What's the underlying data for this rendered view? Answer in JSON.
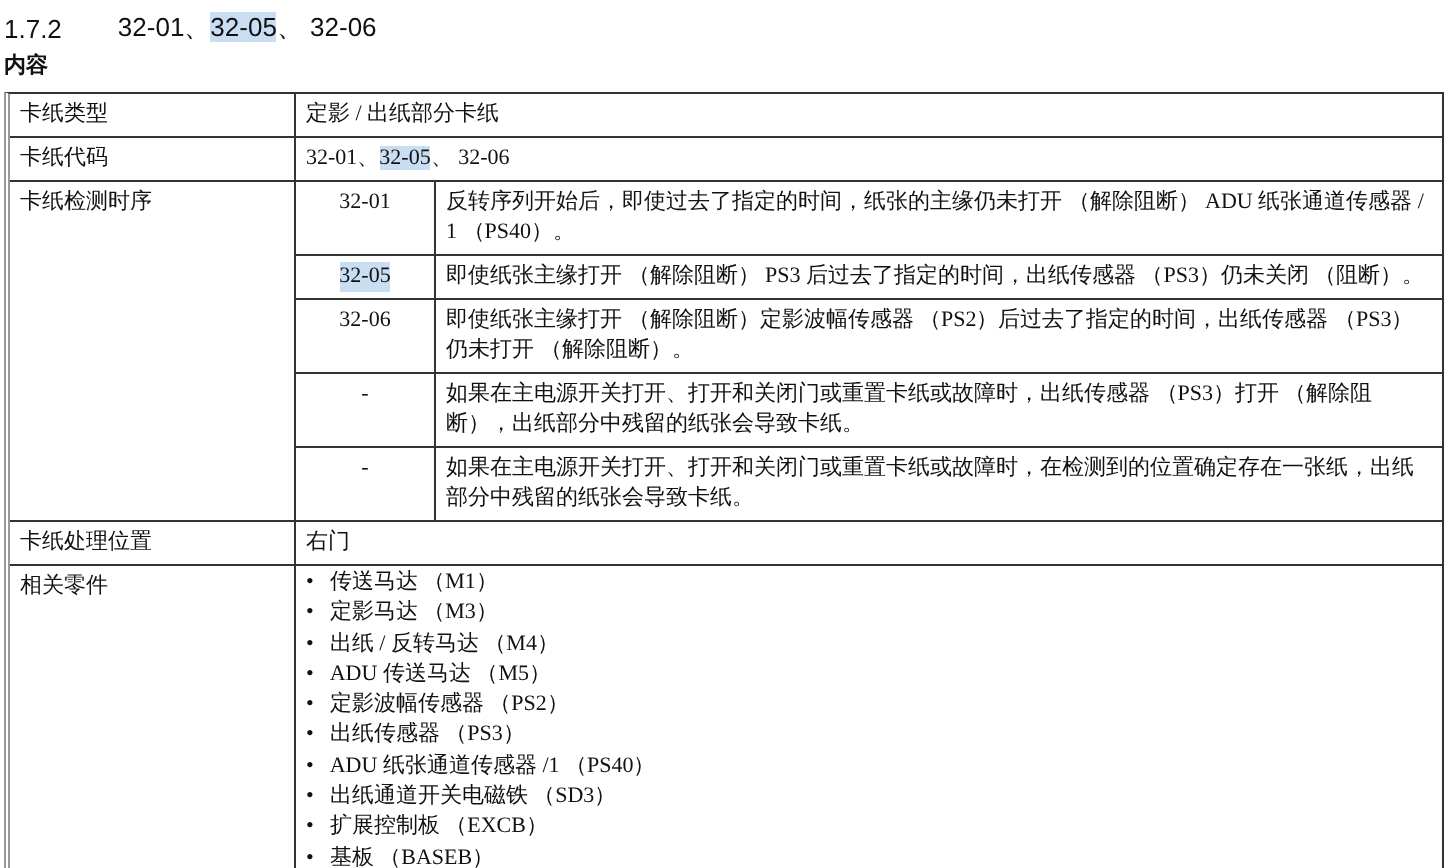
{
  "heading": {
    "number": "1.7.2",
    "codes": [
      {
        "text": "32-01、",
        "highlighted": false
      },
      {
        "text": "32-05",
        "highlighted": true
      },
      {
        "text": "、 32-06",
        "highlighted": false
      }
    ]
  },
  "section_label": "内容",
  "table": {
    "rows": [
      {
        "kind": "text",
        "label": "卡纸类型",
        "value": "定影 / 出纸部分卡纸"
      },
      {
        "kind": "codes",
        "label": "卡纸代码",
        "codes": [
          {
            "text": "32-01、",
            "highlighted": false
          },
          {
            "text": "32-05",
            "highlighted": true
          },
          {
            "text": "、 32-06",
            "highlighted": false
          }
        ]
      },
      {
        "kind": "sequence",
        "label": "卡纸检测时序",
        "entries": [
          {
            "code": "32-01",
            "highlighted": false,
            "description": "反转序列开始后，即使过去了指定的时间，纸张的主缘仍未打开 （解除阻断） ADU 纸张通道传感器 / 1 （PS40）。"
          },
          {
            "code": "32-05",
            "highlighted": true,
            "description": "即使纸张主缘打开 （解除阻断） PS3 后过去了指定的时间，出纸传感器 （PS3）仍未关闭 （阻断）。"
          },
          {
            "code": "32-06",
            "highlighted": false,
            "description": "即使纸张主缘打开 （解除阻断）定影波幅传感器 （PS2）后过去了指定的时间，出纸传感器 （PS3）仍未打开 （解除阻断）。"
          },
          {
            "code": "-",
            "highlighted": false,
            "description": "如果在主电源开关打开、打开和关闭门或重置卡纸或故障时，出纸传感器 （PS3）打开 （解除阻断），出纸部分中残留的纸张会导致卡纸。"
          },
          {
            "code": "-",
            "highlighted": false,
            "description": "如果在主电源开关打开、打开和关闭门或重置卡纸或故障时，在检测到的位置确定存在一张纸，出纸部分中残留的纸张会导致卡纸。"
          }
        ]
      },
      {
        "kind": "text",
        "label": "卡纸处理位置",
        "value": "右门"
      },
      {
        "kind": "list",
        "label": "相关零件",
        "marker": "•",
        "items": [
          "传送马达 （M1）",
          "定影马达 （M3）",
          "出纸 / 反转马达 （M4）",
          "ADU 传送马达 （M5）",
          "定影波幅传感器 （PS2）",
          "出纸传感器 （PS3）",
          "ADU 纸张通道传感器 /1 （PS40）",
          "出纸通道开关电磁铁 （SD3）",
          "扩展控制板 （EXCB）",
          "基板 （BASEB）"
        ]
      }
    ]
  }
}
